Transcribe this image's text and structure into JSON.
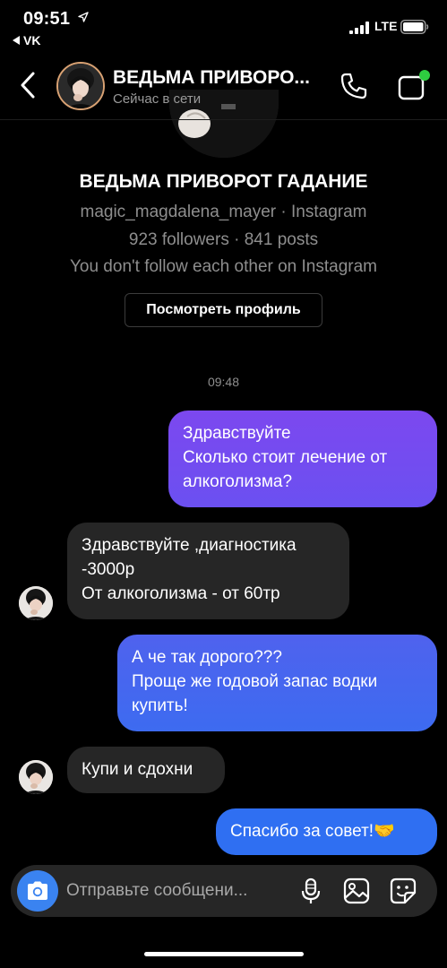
{
  "status_bar": {
    "time": "09:51",
    "back_app": "VK",
    "network": "LTE"
  },
  "header": {
    "title": "ВЕДЬМА ПРИВОРО...",
    "status": "Сейчас в сети"
  },
  "profile": {
    "name": "ВЕДЬМА ПРИВОРОТ ГАДАНИЕ",
    "handle_line": "magic_magdalena_mayer · Instagram",
    "stats_line": "923 followers · 841 posts",
    "follow_line": "You don't follow each other on Instagram",
    "view_profile_label": "Посмотреть профиль"
  },
  "timestamp": "09:48",
  "messages": [
    {
      "from": "me",
      "text": "Здравствуйте\nСколько стоит лечение от\nалкоголизма?"
    },
    {
      "from": "them",
      "text": "Здравствуйте ,диагностика\n-3000р\nОт алкоголизма - от 60тр"
    },
    {
      "from": "me",
      "text": "А че так дорого???\nПроще же годовой запас водки\nкупить!"
    },
    {
      "from": "them",
      "text": "Купи и сдохни"
    },
    {
      "from": "me",
      "text": "Спасибо за совет!🤝"
    }
  ],
  "composer": {
    "placeholder": "Отправьте сообщени..."
  },
  "colors": {
    "background": "#000000",
    "incoming_bubble": "#262626",
    "outgoing_gradient_top": "#7b4af0",
    "outgoing_gradient_bottom": "#2f6ff2",
    "camera_button": "#3a83f0",
    "muted_text": "#8e8e8e"
  }
}
